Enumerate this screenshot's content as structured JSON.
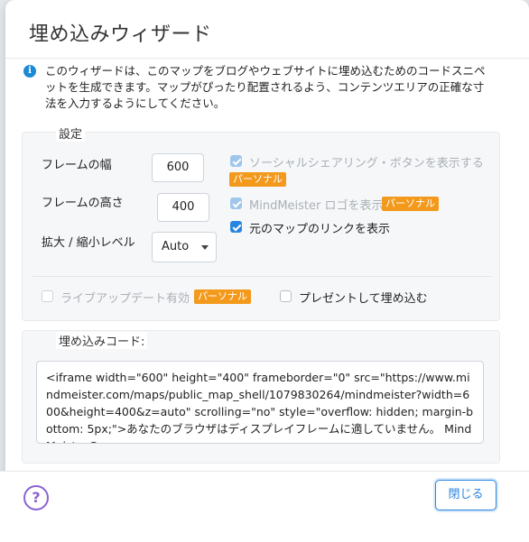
{
  "dialog": {
    "title": "埋め込みウィザード",
    "info_text": "このウィザードは、このマップをブログやウェブサイトに埋め込むためのコードスニペットを生成できます。マップがぴったり配置されるよう、コンテンツエリアの正確な寸法を入力するようにしてください。"
  },
  "settings": {
    "section_label": "設定",
    "frame_width_label": "フレームの幅",
    "frame_width_value": "600",
    "frame_height_label": "フレームの高さ",
    "frame_height_value": "400",
    "zoom_label": "拡大 / 縮小レベル",
    "zoom_value": "Auto",
    "options": {
      "social_share": {
        "label": "ソーシャルシェアリング・ボタンを表示する",
        "checked": true,
        "disabled": true,
        "badge": "パーソナル"
      },
      "mindmeister_logo": {
        "label": "MindMeister ロゴを表示",
        "checked": true,
        "disabled": true,
        "badge": "パーソナル"
      },
      "original_link": {
        "label": "元のマップのリンクを表示",
        "checked": true,
        "disabled": false
      },
      "live_update": {
        "label": "ライブアップデート有効",
        "checked": false,
        "disabled": true,
        "badge": "パーソナル"
      },
      "presentation": {
        "label": "プレゼントして埋め込む",
        "checked": false,
        "disabled": false
      }
    }
  },
  "embed": {
    "section_label": "埋め込みコード:",
    "code": "<iframe width=\"600\" height=\"400\" frameborder=\"0\" src=\"https://www.mindmeister.com/maps/public_map_shell/1079830264/mindmeister?width=600&height=400&z=auto\" scrolling=\"no\" style=\"overflow: hidden; margin-bottom: 5px;\">あなたのブラウザはディスプレイフレームに適していません。 MindMeisterの<a"
  },
  "footer": {
    "help_icon": "?",
    "close_label": "閉じる"
  },
  "colors": {
    "accent": "#2a85e0",
    "badge": "#f39a1d",
    "help": "#8a63d2"
  },
  "icons": {
    "info": "info-icon",
    "help": "question-circle-icon",
    "dropdown": "chevron-down-icon"
  }
}
